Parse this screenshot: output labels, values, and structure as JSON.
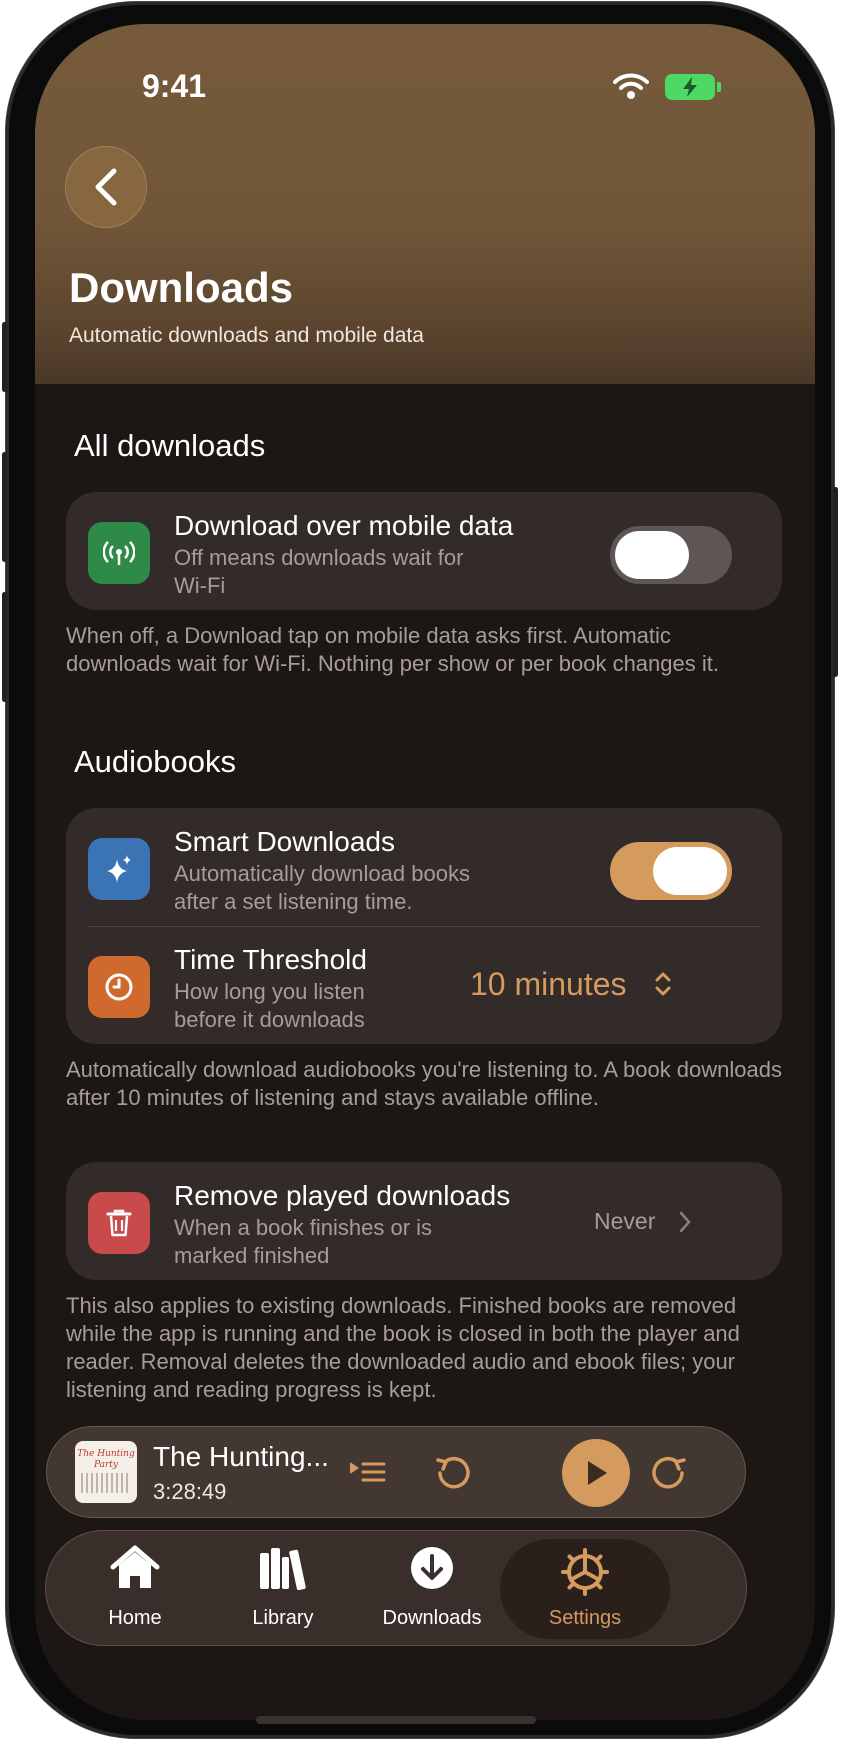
{
  "status": {
    "time": "9:41"
  },
  "header": {
    "title": "Downloads",
    "subtitle": "Automatic downloads and mobile data"
  },
  "sections": {
    "all_downloads": {
      "heading": "All downloads",
      "mobile_data": {
        "title": "Download over mobile data",
        "subtitle": "Off means downloads wait for Wi-Fi",
        "enabled": false
      },
      "footnote": "When off, a Download tap on mobile data asks first. Automatic downloads wait for Wi-Fi. Nothing per show or per book changes it."
    },
    "audiobooks": {
      "heading": "Audiobooks",
      "smart_downloads": {
        "title": "Smart Downloads",
        "subtitle": "Automatically download books after a set listening time.",
        "enabled": true
      },
      "time_threshold": {
        "title": "Time Threshold",
        "subtitle": "How long you listen before it downloads",
        "value": "10 minutes"
      },
      "footnote": "Automatically download audiobooks you're listening to. A book downloads after 10 minutes of listening and stays available offline.",
      "remove_played": {
        "title": "Remove played downloads",
        "subtitle": "When a book finishes or is marked finished",
        "value": "Never"
      },
      "footnote2": "This also applies to existing downloads. Finished books are removed while the app is running and the book is closed in both the player and reader. Removal deletes the downloaded audio and ebook files; your listening and reading progress is kept."
    }
  },
  "mini_player": {
    "title": "The Hunting...",
    "time": "3:28:49",
    "cover_text": "The Hunting Party"
  },
  "tabbar": {
    "tabs": [
      {
        "label": "Home",
        "icon": "home-icon"
      },
      {
        "label": "Library",
        "icon": "library-icon"
      },
      {
        "label": "Downloads",
        "icon": "download-icon"
      },
      {
        "label": "Settings",
        "icon": "gear-icon",
        "active": true
      }
    ]
  },
  "colors": {
    "accent": "#d49a5e",
    "header_brown": "#765a3b",
    "background": "#1c1614",
    "card": "#322b29",
    "green_icon": "#2f8a48",
    "blue_icon": "#3a74b4",
    "orange_icon": "#d0692d",
    "red_icon": "#c84a4a"
  }
}
